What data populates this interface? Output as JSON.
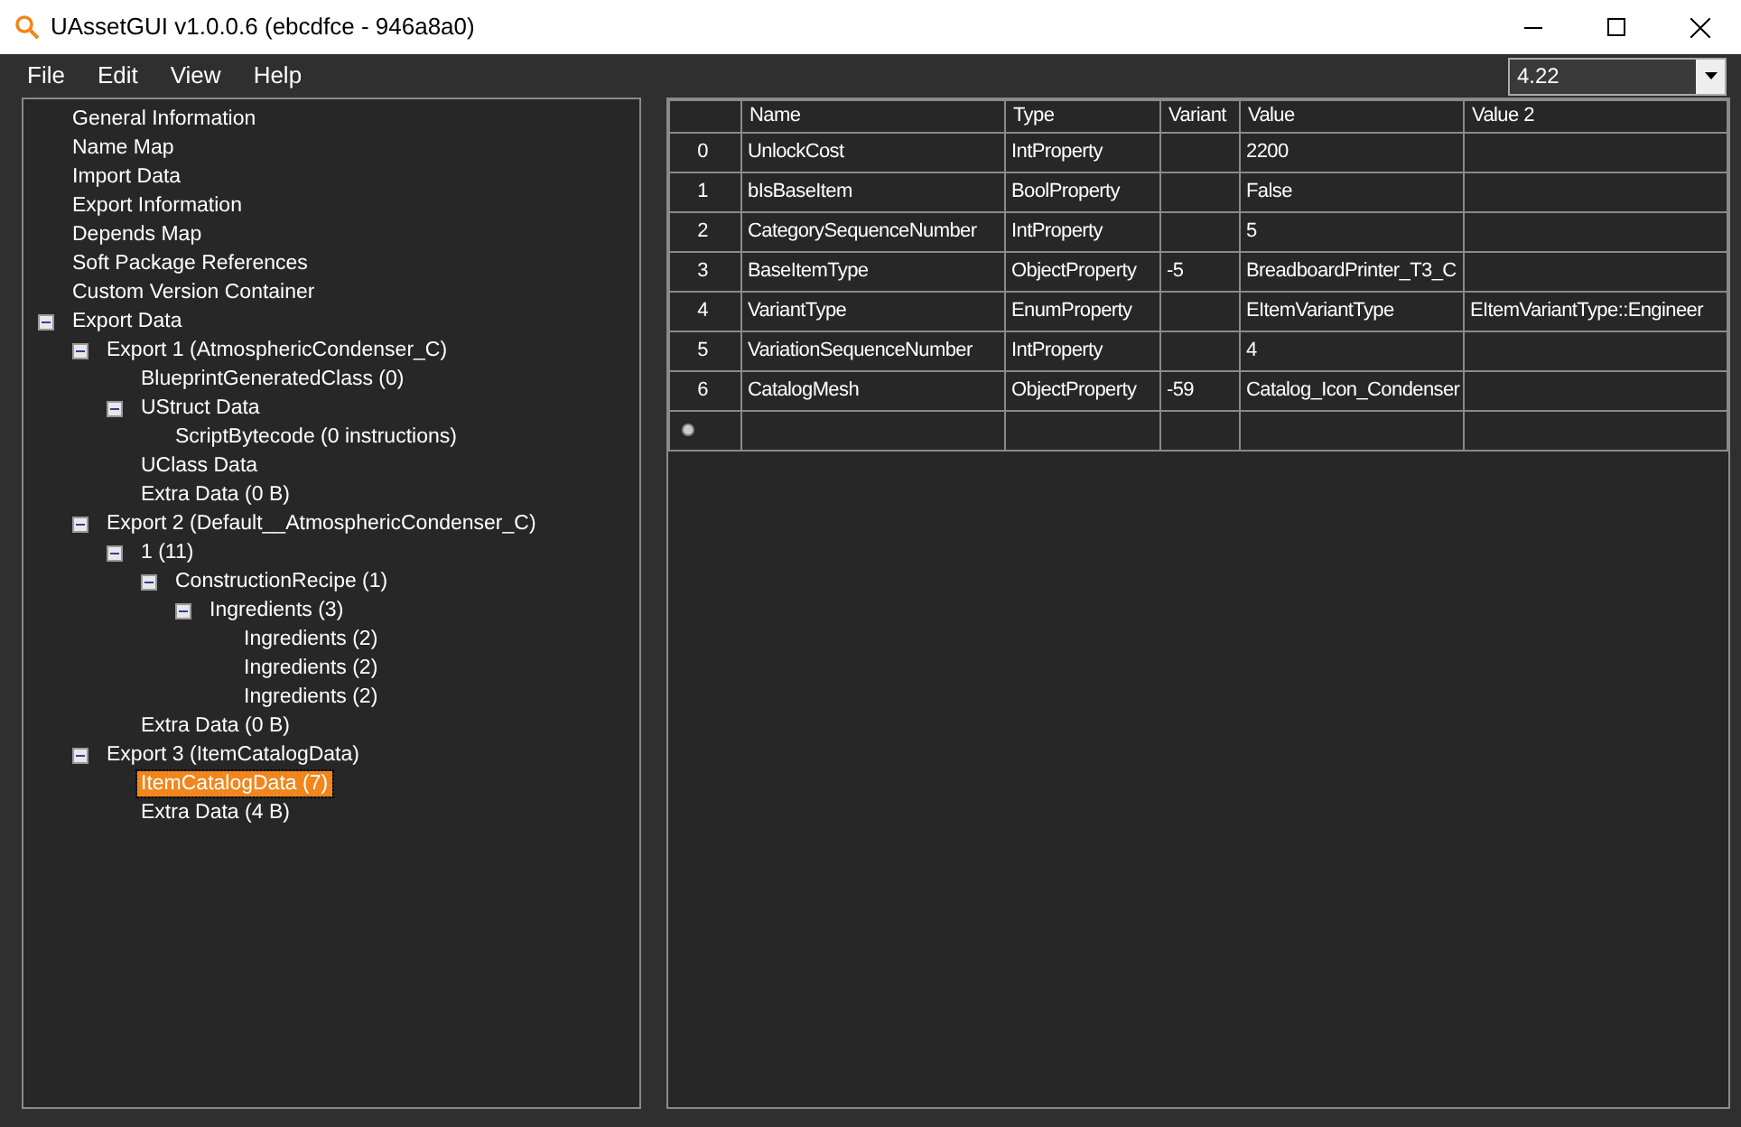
{
  "window": {
    "title": "UAssetGUI v1.0.0.6 (ebcdfce - 946a8a0)"
  },
  "menu": [
    "File",
    "Edit",
    "View",
    "Help"
  ],
  "version_select": {
    "value": "4.22"
  },
  "tree": [
    {
      "label": "General Information",
      "selected": false
    },
    {
      "label": "Name Map",
      "selected": false
    },
    {
      "label": "Import Data",
      "selected": false
    },
    {
      "label": "Export Information",
      "selected": false
    },
    {
      "label": "Depends Map",
      "selected": false
    },
    {
      "label": "Soft Package References",
      "selected": false
    },
    {
      "label": "Custom Version Container",
      "selected": false
    },
    {
      "label": "Export Data",
      "selected": false,
      "expanded": true,
      "children": [
        {
          "label": "Export 1 (AtmosphericCondenser_C)",
          "selected": false,
          "expanded": true,
          "children": [
            {
              "label": "BlueprintGeneratedClass (0)",
              "selected": false
            },
            {
              "label": "UStruct Data",
              "selected": false,
              "expanded": true,
              "children": [
                {
                  "label": "ScriptBytecode (0 instructions)",
                  "selected": false
                }
              ]
            },
            {
              "label": "UClass Data",
              "selected": false
            },
            {
              "label": "Extra Data (0 B)",
              "selected": false
            }
          ]
        },
        {
          "label": "Export 2 (Default__AtmosphericCondenser_C)",
          "selected": false,
          "expanded": true,
          "children": [
            {
              "label": "1 (11)",
              "selected": false,
              "expanded": true,
              "children": [
                {
                  "label": "ConstructionRecipe (1)",
                  "selected": false,
                  "expanded": true,
                  "children": [
                    {
                      "label": "Ingredients (3)",
                      "selected": false,
                      "expanded": true,
                      "children": [
                        {
                          "label": "Ingredients (2)",
                          "selected": false
                        },
                        {
                          "label": "Ingredients (2)",
                          "selected": false
                        },
                        {
                          "label": "Ingredients (2)",
                          "selected": false
                        }
                      ]
                    }
                  ]
                }
              ]
            },
            {
              "label": "Extra Data (0 B)",
              "selected": false
            }
          ]
        },
        {
          "label": "Export 3 (ItemCatalogData)",
          "selected": false,
          "expanded": true,
          "children": [
            {
              "label": "ItemCatalogData (7)",
              "selected": true
            },
            {
              "label": "Extra Data (4 B)",
              "selected": false
            }
          ]
        }
      ]
    }
  ],
  "table": {
    "columns": [
      "Name",
      "Type",
      "Variant",
      "Value",
      "Value 2"
    ],
    "rows": [
      {
        "index": "0",
        "cells": [
          "UnlockCost",
          "IntProperty",
          "",
          "2200",
          ""
        ]
      },
      {
        "index": "1",
        "cells": [
          "bIsBaseItem",
          "BoolProperty",
          "",
          "False",
          ""
        ]
      },
      {
        "index": "2",
        "cells": [
          "CategorySequenceNumber",
          "IntProperty",
          "",
          "5",
          ""
        ]
      },
      {
        "index": "3",
        "cells": [
          "BaseItemType",
          "ObjectProperty",
          "-5",
          "BreadboardPrinter_T3_C",
          ""
        ]
      },
      {
        "index": "4",
        "cells": [
          "VariantType",
          "EnumProperty",
          "",
          "EItemVariantType",
          "EItemVariantType::Engineer"
        ]
      },
      {
        "index": "5",
        "cells": [
          "VariationSequenceNumber",
          "IntProperty",
          "",
          "4",
          ""
        ]
      },
      {
        "index": "6",
        "cells": [
          "CatalogMesh",
          "ObjectProperty",
          "-59",
          "Catalog_Icon_Condenser",
          ""
        ]
      }
    ]
  }
}
